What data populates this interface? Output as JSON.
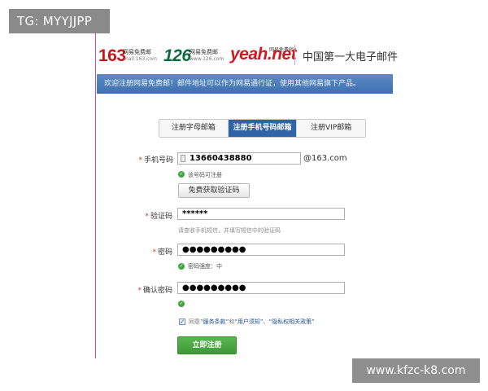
{
  "watermark": {
    "top": "TG: MYYJJPP",
    "bottom": "www.kfzc-k8.com"
  },
  "header": {
    "logo_163": {
      "number": "163",
      "cn": "网易免费邮",
      "domain": "mail.163.com"
    },
    "logo_126": {
      "number": "126",
      "cn": "网易免费邮",
      "domain": "www.126.com"
    },
    "logo_yeah": {
      "word": "yeah.net",
      "cn": "网易免费邮"
    },
    "slogan": "中国第一大电子邮件"
  },
  "notice": "欢迎注册网易免费邮！邮件地址可以作为网易通行证，使用其他网易旗下产品。",
  "tabs": [
    {
      "label": "注册字母邮箱",
      "active": false
    },
    {
      "label": "注册手机号码邮箱",
      "active": true
    },
    {
      "label": "注册VIP邮箱",
      "active": false
    }
  ],
  "form": {
    "phone": {
      "label": "手机号码",
      "value": "13660438880",
      "domain": "@163.com",
      "hint": "该号码可注册"
    },
    "get_code_button": "免费获取验证码",
    "code": {
      "label": "验证码",
      "value": "******",
      "hint": "请查收手机短信，并填写短信中的验证码"
    },
    "password": {
      "label": "密码",
      "value": "●●●●●●●●●",
      "hint": "密码强度：中"
    },
    "confirm": {
      "label": "确认密码",
      "value": "●●●●●●●●●"
    },
    "agree": {
      "prefix": "同意",
      "link1": "“服务条款”",
      "mid": "和",
      "link2": "“用户须知”",
      "sep": "、",
      "link3": "“隐私权相关政策”",
      "checked": true
    },
    "submit_button": "立即注册"
  },
  "colors": {
    "accent_blue": "#2f64a6",
    "ok_green": "#3ea83e",
    "brand_red": "#c6161d"
  }
}
